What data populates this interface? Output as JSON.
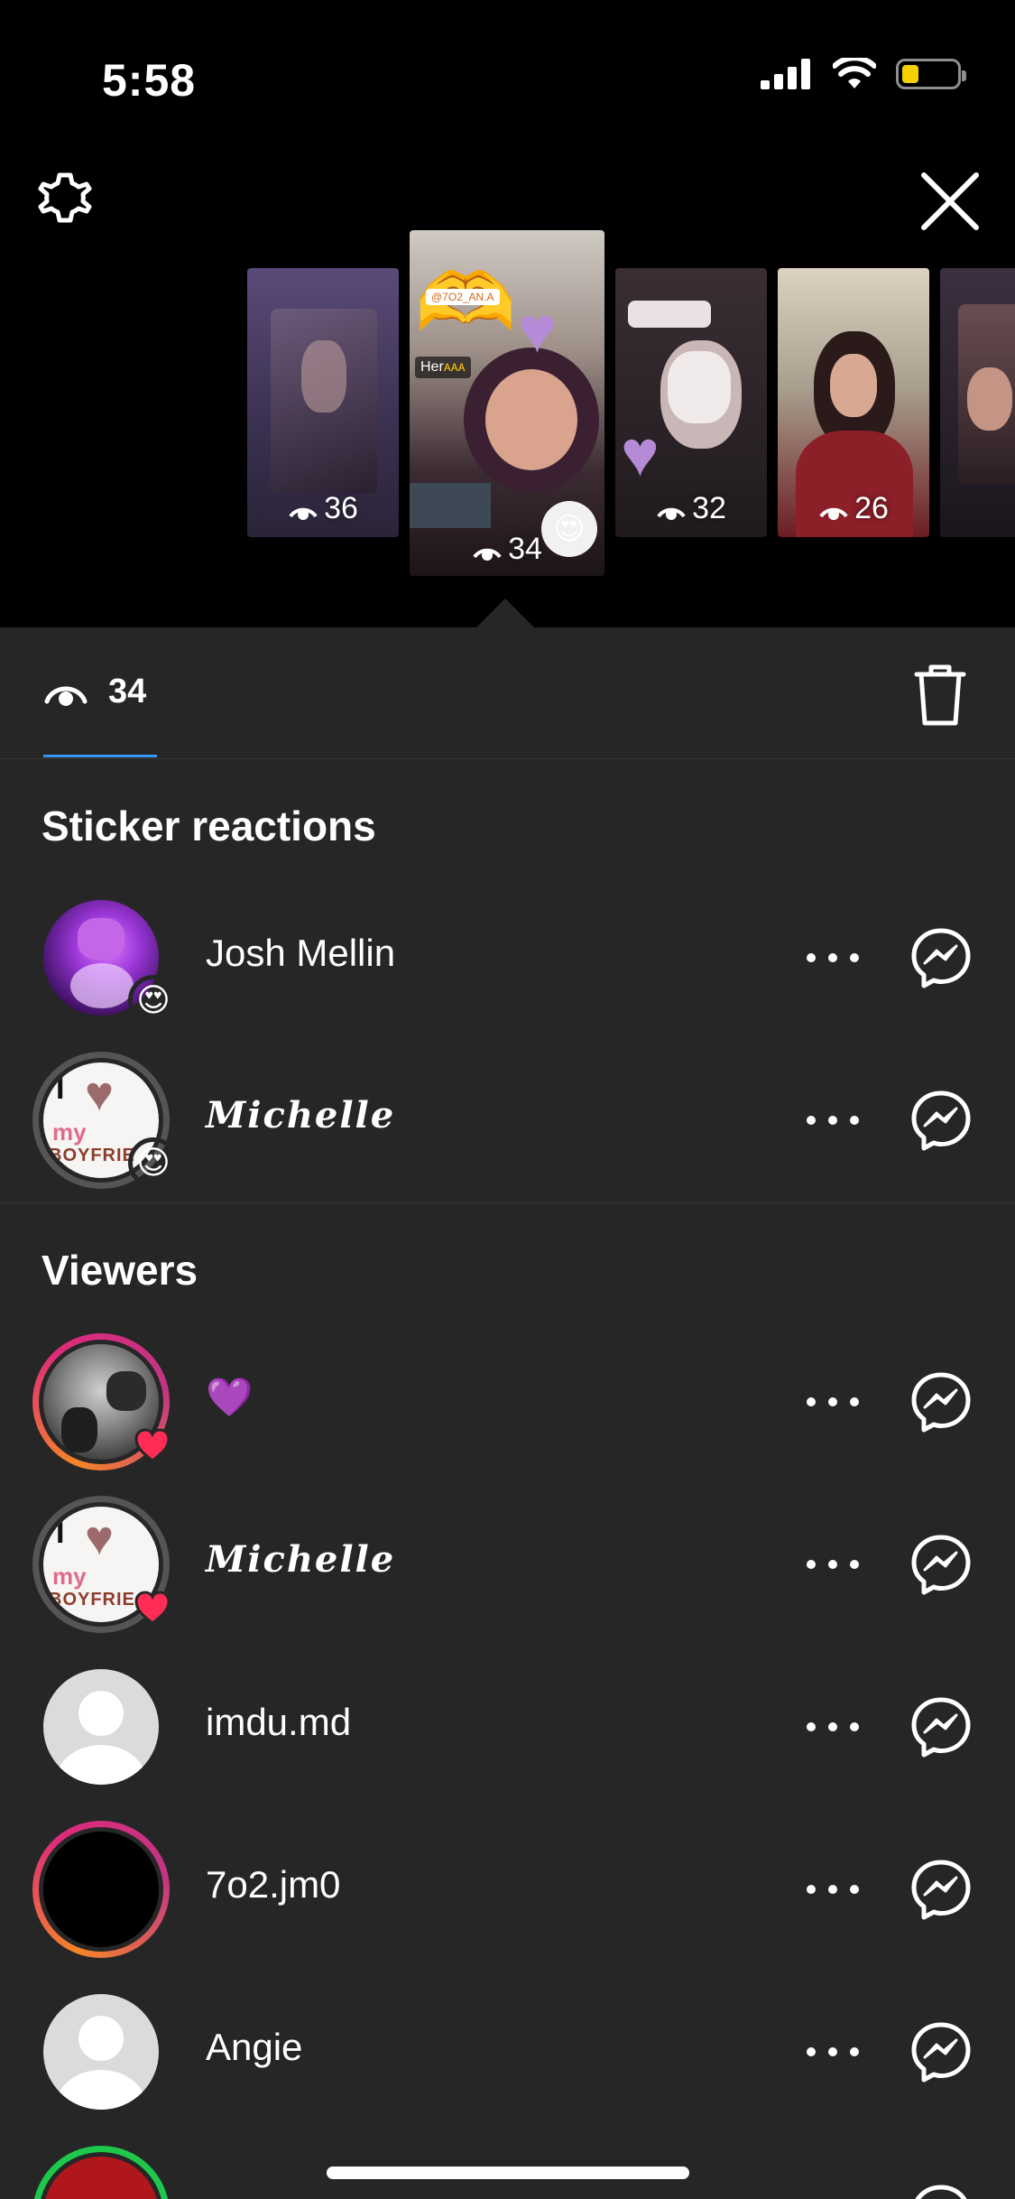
{
  "status_bar": {
    "time": "5:58"
  },
  "story_thumbnails": [
    {
      "views": "36"
    },
    {
      "views": "34",
      "selected": true,
      "sticker_text": "Her",
      "tag_text": "@7O2_AN.A"
    },
    {
      "views": "32"
    },
    {
      "views": "26"
    },
    {
      "views": ""
    }
  ],
  "views_bar": {
    "count": "34"
  },
  "sticker_reactions": {
    "title": "Sticker reactions",
    "items": [
      {
        "name": "Josh Mellin",
        "reaction": "😍"
      },
      {
        "name": "𝑴𝒊𝒄𝒉𝒆𝒍𝒍𝒆",
        "reaction": "😍"
      }
    ]
  },
  "viewers": {
    "title": "Viewers",
    "items": [
      {
        "name": "💜",
        "liked": true,
        "ring": "story"
      },
      {
        "name": "𝑴𝒊𝒄𝒉𝒆𝒍𝒍𝒆",
        "liked": true,
        "ring": "none"
      },
      {
        "name": "imdu.md",
        "liked": false,
        "ring": "none"
      },
      {
        "name": "7o2.jm0",
        "liked": false,
        "ring": "story"
      },
      {
        "name": "Angie",
        "liked": false,
        "ring": "none"
      },
      {
        "name": "",
        "liked": false,
        "ring": "close-friends"
      }
    ]
  },
  "colors": {
    "background": "#262626",
    "top_background": "#000000",
    "accent_blue": "#3897f0",
    "heart_red": "#ff2d55",
    "story_ring_start": "#f58529",
    "story_ring_end": "#dd2a7b",
    "close_friends_ring": "#1ec84b"
  }
}
